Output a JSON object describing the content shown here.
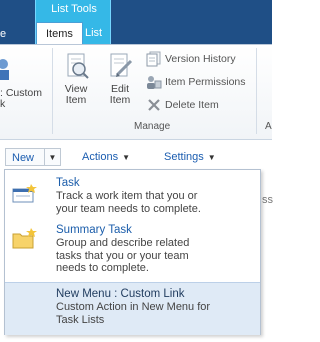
{
  "ribbon": {
    "contextual_group_label": "List Tools",
    "tabs": [
      {
        "label": "e"
      },
      {
        "label": "Items"
      },
      {
        "label": "List"
      }
    ],
    "left_partial_label": ": Custom\nk",
    "buttons": {
      "view_item": "View\nItem",
      "edit_item": "Edit\nItem",
      "version_history": "Version History",
      "item_permissions": "Item Permissions",
      "delete_item": "Delete Item"
    },
    "groups": {
      "manage": "Manage",
      "right_partial": "A"
    }
  },
  "toolbar": {
    "new_label": "New",
    "actions_label": "Actions",
    "settings_label": "Settings"
  },
  "menu": {
    "items": [
      {
        "title": "Task",
        "description": "Track a work item that you or\nyour team needs to complete."
      },
      {
        "title": "Summary Task",
        "description": "Group and describe related\ntasks that you or your team\nneeds to complete."
      },
      {
        "title": "New Menu : Custom Link",
        "description": "Custom Action in New Menu for\nTask Lists"
      }
    ]
  },
  "edge_partial_text": "ss",
  "colors": {
    "tab_bar": "#1f4f86",
    "contextual_group": "#35b8e7",
    "link_blue": "#1b5db0",
    "menu_highlight": "#dfeaf6"
  },
  "icons": {
    "view_item": "view-item-icon",
    "edit_item": "edit-item-icon",
    "version_history": "version-history-icon",
    "item_permissions": "item-permissions-icon",
    "delete_item": "delete-icon",
    "task": "task-icon",
    "summary_task": "folder-icon"
  }
}
